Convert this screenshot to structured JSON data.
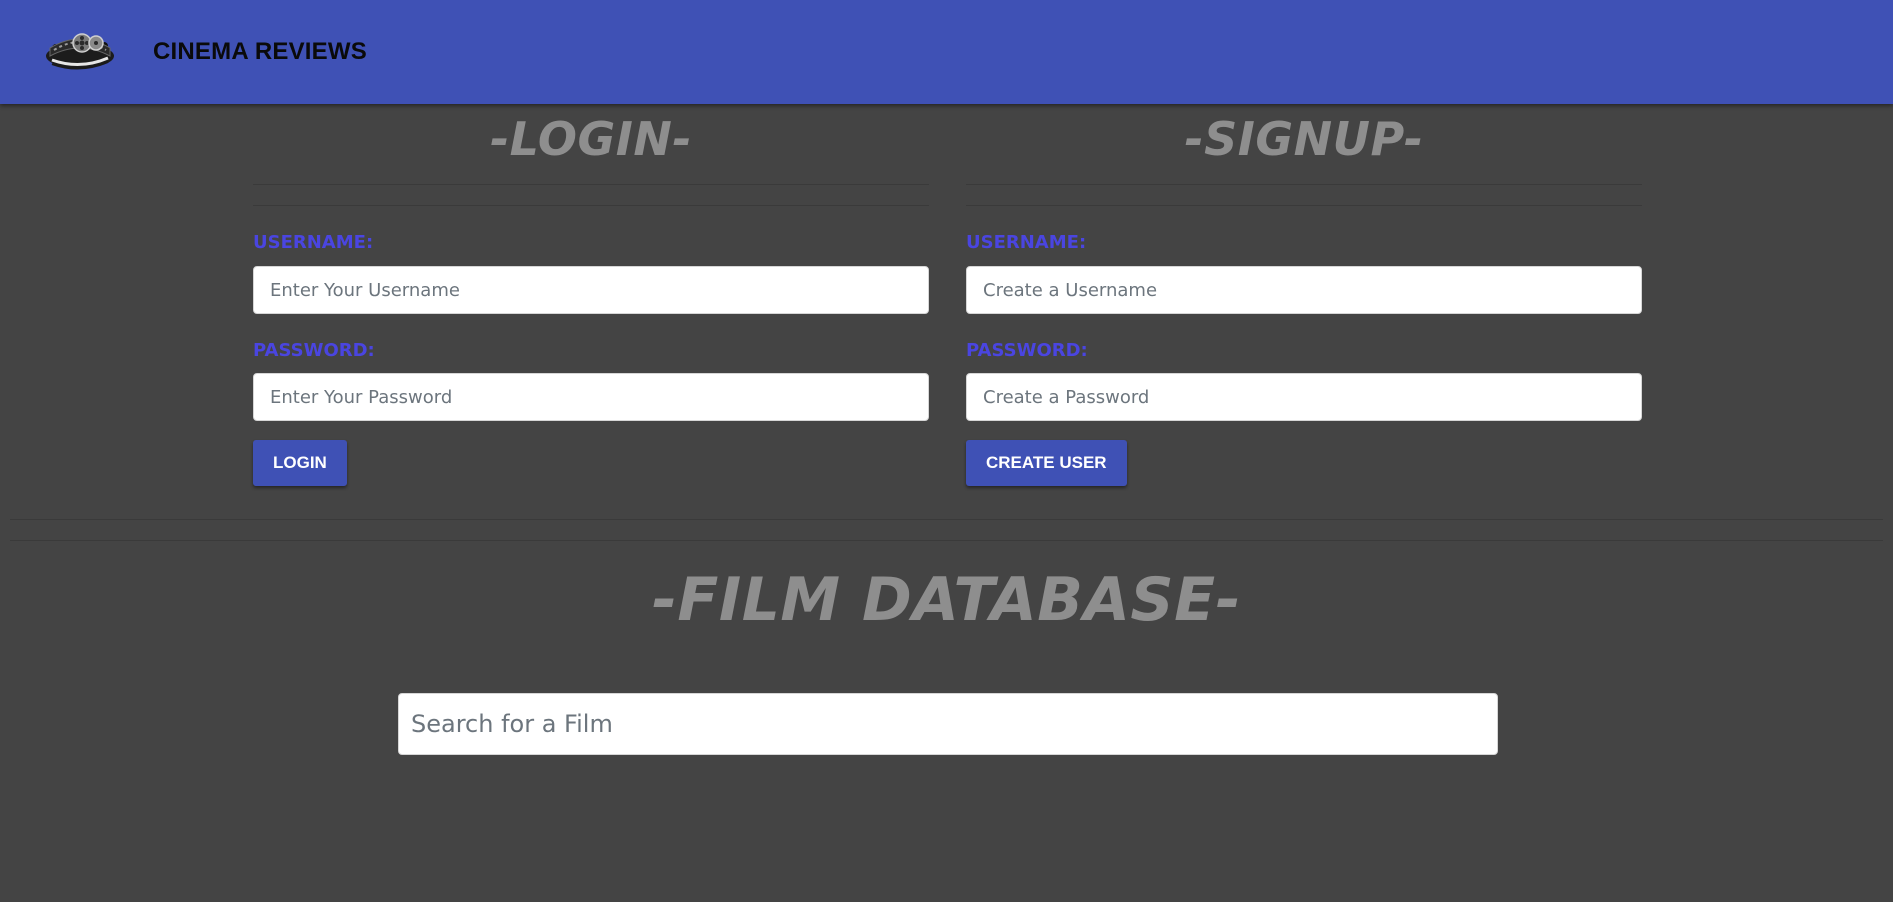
{
  "app": {
    "brand": "CINEMA REVIEWS",
    "logo_icon": "film-reel-logo-icon",
    "nav_color": "#3f51b5"
  },
  "login": {
    "title": "-LOGIN-",
    "username_label": "USERNAME:",
    "username_placeholder": "Enter Your Username",
    "username_value": "",
    "password_label": "PASSWORD:",
    "password_placeholder": "Enter Your Password",
    "password_value": "",
    "button_label": "LOGIN"
  },
  "signup": {
    "title": "-SIGNUP-",
    "username_label": "USERNAME:",
    "username_placeholder": "Create a Username",
    "username_value": "",
    "password_label": "PASSWORD:",
    "password_placeholder": "Create a Password",
    "password_value": "",
    "button_label": "CREATE USER"
  },
  "database": {
    "title": "-FILM DATABASE-",
    "search_placeholder": "Search for a Film",
    "search_value": ""
  },
  "colors": {
    "background": "#444444",
    "label": "#4a45e0",
    "heading": "#8e8e8e",
    "button": "#3f51b5"
  }
}
